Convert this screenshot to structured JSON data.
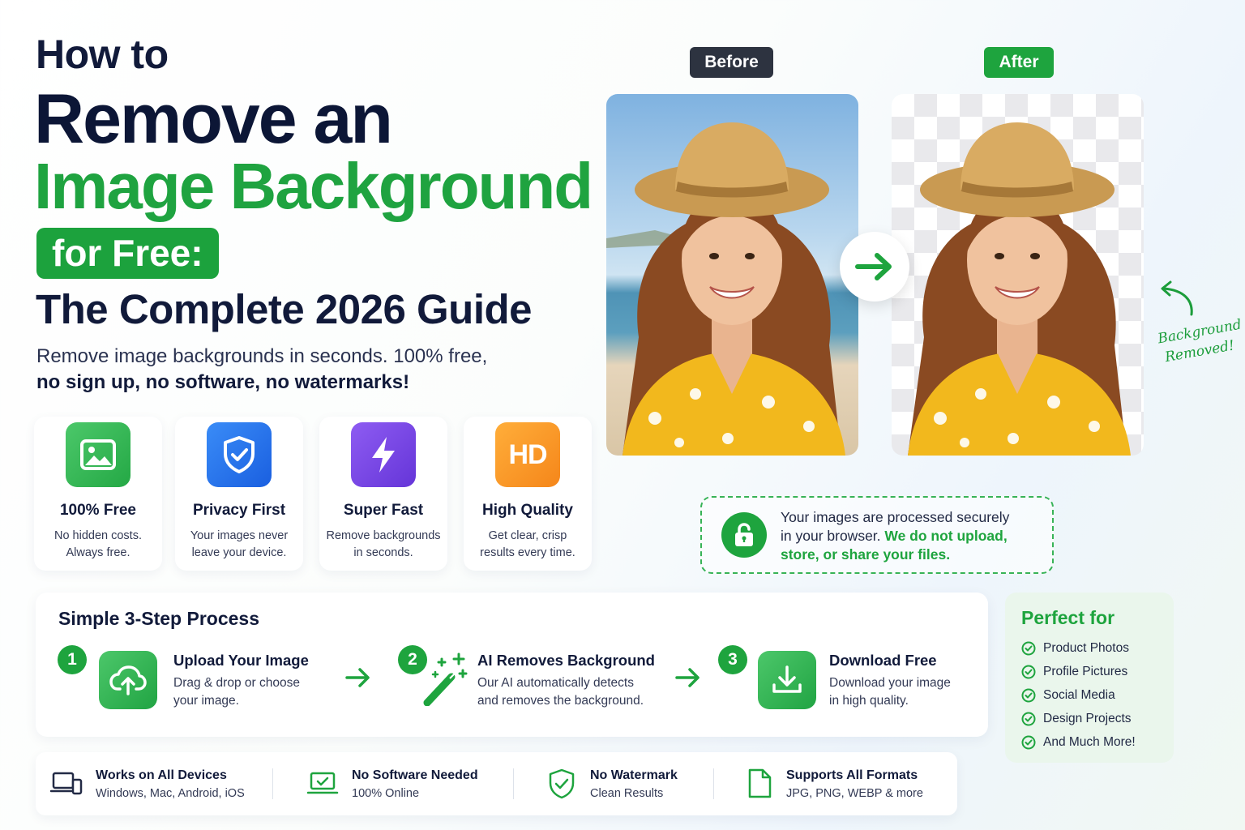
{
  "headline": {
    "line1": "How to",
    "line2": "Remove an",
    "line3": "Image Background",
    "line4": "for Free:",
    "line5": "The Complete 2026 Guide"
  },
  "subtitle": {
    "line1": "Remove image backgrounds in seconds. 100% free,",
    "line2": "no sign up, no software, no watermarks!"
  },
  "features": [
    {
      "icon": "image-icon",
      "title": "100% Free",
      "desc1": "No hidden costs.",
      "desc2": "Always free.",
      "color": "#2bb24f"
    },
    {
      "icon": "shield-check-icon",
      "title": "Privacy First",
      "desc1": "Your images never",
      "desc2": "leave your device.",
      "color": "#1f6ff0"
    },
    {
      "icon": "lightning-icon",
      "title": "Super Fast",
      "desc1": "Remove backgrounds",
      "desc2": "in seconds.",
      "color": "#7a45e6"
    },
    {
      "icon": "hd-icon",
      "title": "High Quality",
      "desc1": "Get clear, crisp",
      "desc2": "results every time.",
      "color": "#f7921e",
      "badge_text": "HD"
    }
  ],
  "comparison": {
    "before_label": "Before",
    "after_label": "After",
    "annotation_line1": "Background",
    "annotation_line2": "Removed!"
  },
  "secure_note": {
    "text_plain1": "Your images are processed securely",
    "text_plain2": "in your browser. ",
    "text_bold1": "We do not upload,",
    "text_bold2": "store, or share your files."
  },
  "steps": {
    "title": "Simple 3-Step Process",
    "items": [
      {
        "number": "1",
        "icon": "cloud-upload-icon",
        "title": "Upload Your Image",
        "desc1": "Drag & drop or choose",
        "desc2": "your image."
      },
      {
        "number": "2",
        "icon": "magic-wand-icon",
        "title": "AI Removes Background",
        "desc1": "Our AI automatically detects",
        "desc2": "and removes the background."
      },
      {
        "number": "3",
        "icon": "download-icon",
        "title": "Download Free",
        "desc1": "Download your image",
        "desc2": "in high quality."
      }
    ]
  },
  "perfect_for": {
    "title": "Perfect for",
    "items": [
      "Product Photos",
      "Profile Pictures",
      "Social Media",
      "Design Projects",
      "And Much More!"
    ]
  },
  "bottom_bar": [
    {
      "icon": "devices-icon",
      "title": "Works on All Devices",
      "desc": "Windows, Mac, Android, iOS"
    },
    {
      "icon": "laptop-check-icon",
      "title": "No Software Needed",
      "desc": "100% Online"
    },
    {
      "icon": "shield-check-icon",
      "title": "No Watermark",
      "desc": "Clean Results"
    },
    {
      "icon": "file-icon",
      "title": "Supports All Formats",
      "desc": "JPG, PNG, WEBP & more"
    }
  ],
  "colors": {
    "brand_green": "#1ea43e",
    "navy": "#111a3a",
    "before_badge": "#2d3340",
    "after_badge": "#1ea43e"
  }
}
